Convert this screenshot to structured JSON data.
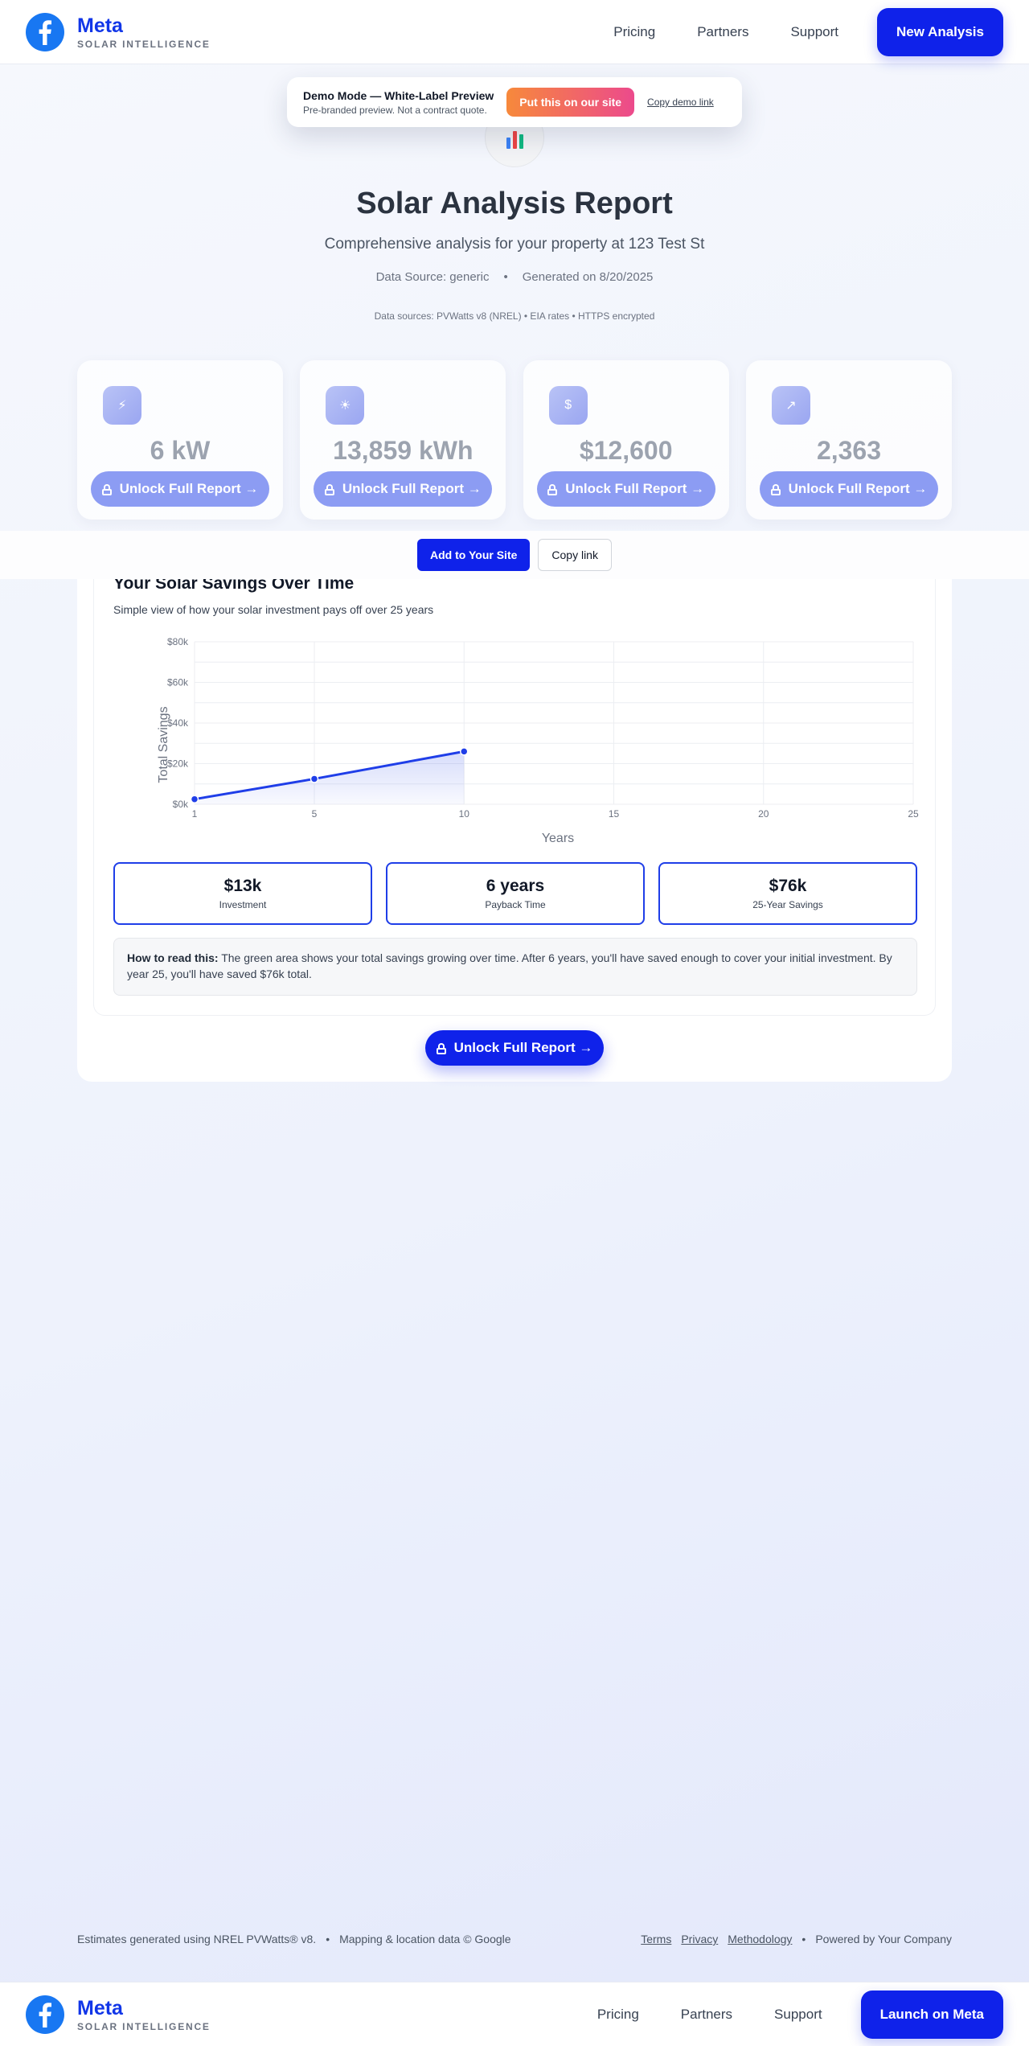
{
  "header": {
    "brand_name": "Meta",
    "brand_sub": "SOLAR INTELLIGENCE",
    "nav": [
      "Pricing",
      "Partners",
      "Support"
    ],
    "cta": "New Analysis"
  },
  "demo_banner": {
    "title": "Demo Mode — White-Label Preview",
    "subtitle": "Pre-branded preview. Not a contract quote.",
    "cta": "Put this on our site",
    "link": "Copy demo link"
  },
  "hero": {
    "icon": "bar-chart-icon",
    "title": "Solar Analysis Report",
    "subtitle": "Comprehensive analysis for your property at 123 Test St",
    "data_source": "Data Source: generic",
    "generated": "Generated on 8/20/2025",
    "sources": "Data sources: PVWatts v8 (NREL) • EIA rates • HTTPS encrypted"
  },
  "metrics": [
    {
      "icon": "lightning-icon",
      "glyph": "⚡",
      "value": "6 kW",
      "button": "Unlock Full Report →"
    },
    {
      "icon": "sun-icon",
      "glyph": "☀",
      "value": "13,859 kWh",
      "button": "Unlock Full Report →"
    },
    {
      "icon": "money-icon",
      "glyph": "$",
      "value": "$12,600",
      "button": "Unlock Full Report →"
    },
    {
      "icon": "trend-chart-icon",
      "glyph": "↗",
      "value": "2,363",
      "button": "Unlock Full Report →"
    }
  ],
  "actions": {
    "add": "Add to Your Site",
    "copy": "Copy link"
  },
  "savings": {
    "title": "Your Solar Savings Over Time",
    "subtitle": "Simple view of how your solar investment pays off over 25 years",
    "stats": [
      {
        "value": "$13k",
        "label": "Investment"
      },
      {
        "value": "6 years",
        "label": "Payback Time"
      },
      {
        "value": "$76k",
        "label": "25-Year Savings"
      }
    ],
    "howto_label": "How to read this:",
    "howto_text": " The green area shows your total savings growing over time. After 6 years, you'll have saved enough to cover your initial investment. By year 25, you'll have saved $76k total.",
    "unlock": "Unlock Full Report →"
  },
  "chart_data": {
    "type": "area",
    "title": "",
    "xlabel": "Years",
    "ylabel": "Total Savings",
    "x_ticks": [
      "1",
      "5",
      "10",
      "15",
      "20",
      "25"
    ],
    "y_ticks": [
      "$0k",
      "$20k",
      "$40k",
      "$60k",
      "$80k"
    ],
    "xlim": [
      1,
      25
    ],
    "ylim": [
      0,
      80000
    ],
    "grid": true,
    "series": [
      {
        "x": [
          1,
          5,
          10
        ],
        "y": [
          2500,
          12500,
          26000
        ],
        "color": "#1f3ee8"
      }
    ]
  },
  "footer": {
    "left_1": "Estimates generated using NREL PVWatts® v8.",
    "left_2": "Mapping & location data © Google",
    "links": [
      "Terms",
      "Privacy",
      "Methodology"
    ],
    "powered": "Powered by Your Company"
  },
  "bottom_bar": {
    "brand_name": "Meta",
    "brand_sub": "SOLAR INTELLIGENCE",
    "nav": [
      "Pricing",
      "Partners",
      "Support"
    ],
    "cta": "Launch on Meta"
  },
  "colors": {
    "accent": "#0f22ea",
    "brand": "#1877f2",
    "muted_button": "#8c9cf3"
  }
}
